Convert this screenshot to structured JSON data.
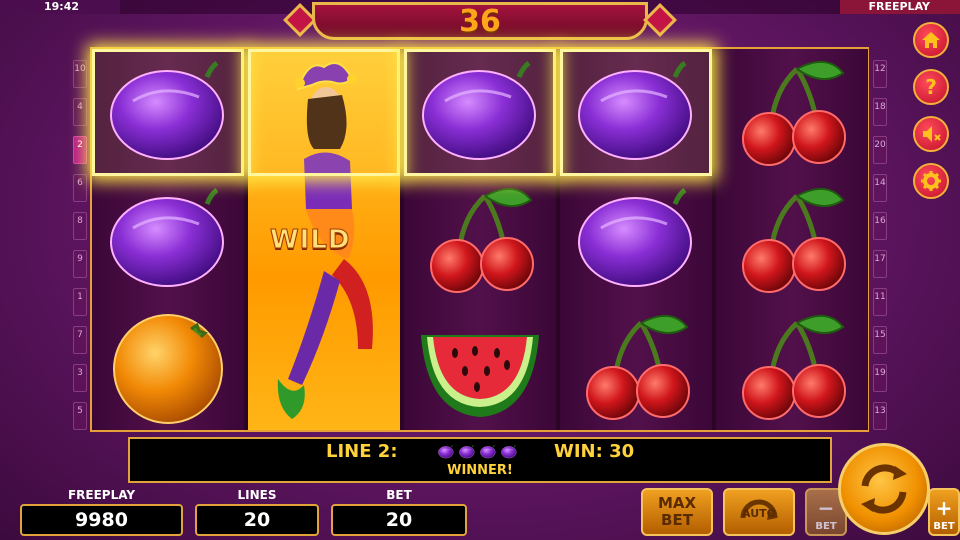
{
  "status_bar": {
    "time": "19:42",
    "mode": "FREEPLAY"
  },
  "counter": {
    "value": "36"
  },
  "reels": [
    [
      "plum",
      "plum",
      "orange"
    ],
    [
      "wild",
      "wild",
      "wild"
    ],
    [
      "plum",
      "cherries",
      "watermelon"
    ],
    [
      "plum",
      "plum",
      "cherries"
    ],
    [
      "cherries",
      "cherries",
      "cherries"
    ]
  ],
  "winning_cells": [
    [
      0,
      0
    ],
    [
      1,
      0
    ],
    [
      2,
      0
    ],
    [
      3,
      0
    ]
  ],
  "wild_label": "WILD",
  "paylines": {
    "left": [
      "10",
      "4",
      "2",
      "6",
      "8",
      "9",
      "1",
      "7",
      "3",
      "5"
    ],
    "right": [
      "12",
      "18",
      "20",
      "14",
      "16",
      "17",
      "11",
      "15",
      "19",
      "13"
    ],
    "active": "2"
  },
  "win_info": {
    "line_label": "LINE 2:",
    "symbol": "plum",
    "symbol_count": 4,
    "win_label": "WIN: 30",
    "status": "WINNER!"
  },
  "stats": {
    "freeplay": {
      "label": "FREEPLAY",
      "value": "9980"
    },
    "lines": {
      "label": "LINES",
      "value": "20"
    },
    "bet": {
      "label": "BET",
      "value": "20"
    }
  },
  "buttons": {
    "max_bet_line1": "MAX",
    "max_bet_line2": "BET",
    "auto": "AUTO",
    "bet_minus_label": "BET",
    "bet_minus_sign": "−",
    "bet_plus_label": "BET",
    "bet_plus_sign": "+"
  },
  "side_menu": [
    "home-icon",
    "help-icon",
    "sound-off-icon",
    "settings-icon"
  ],
  "colors": {
    "accent": "#ffd23c",
    "frame": "#e0a43a",
    "counter": "#ffa41c",
    "win_glow": "#ffe84a"
  }
}
